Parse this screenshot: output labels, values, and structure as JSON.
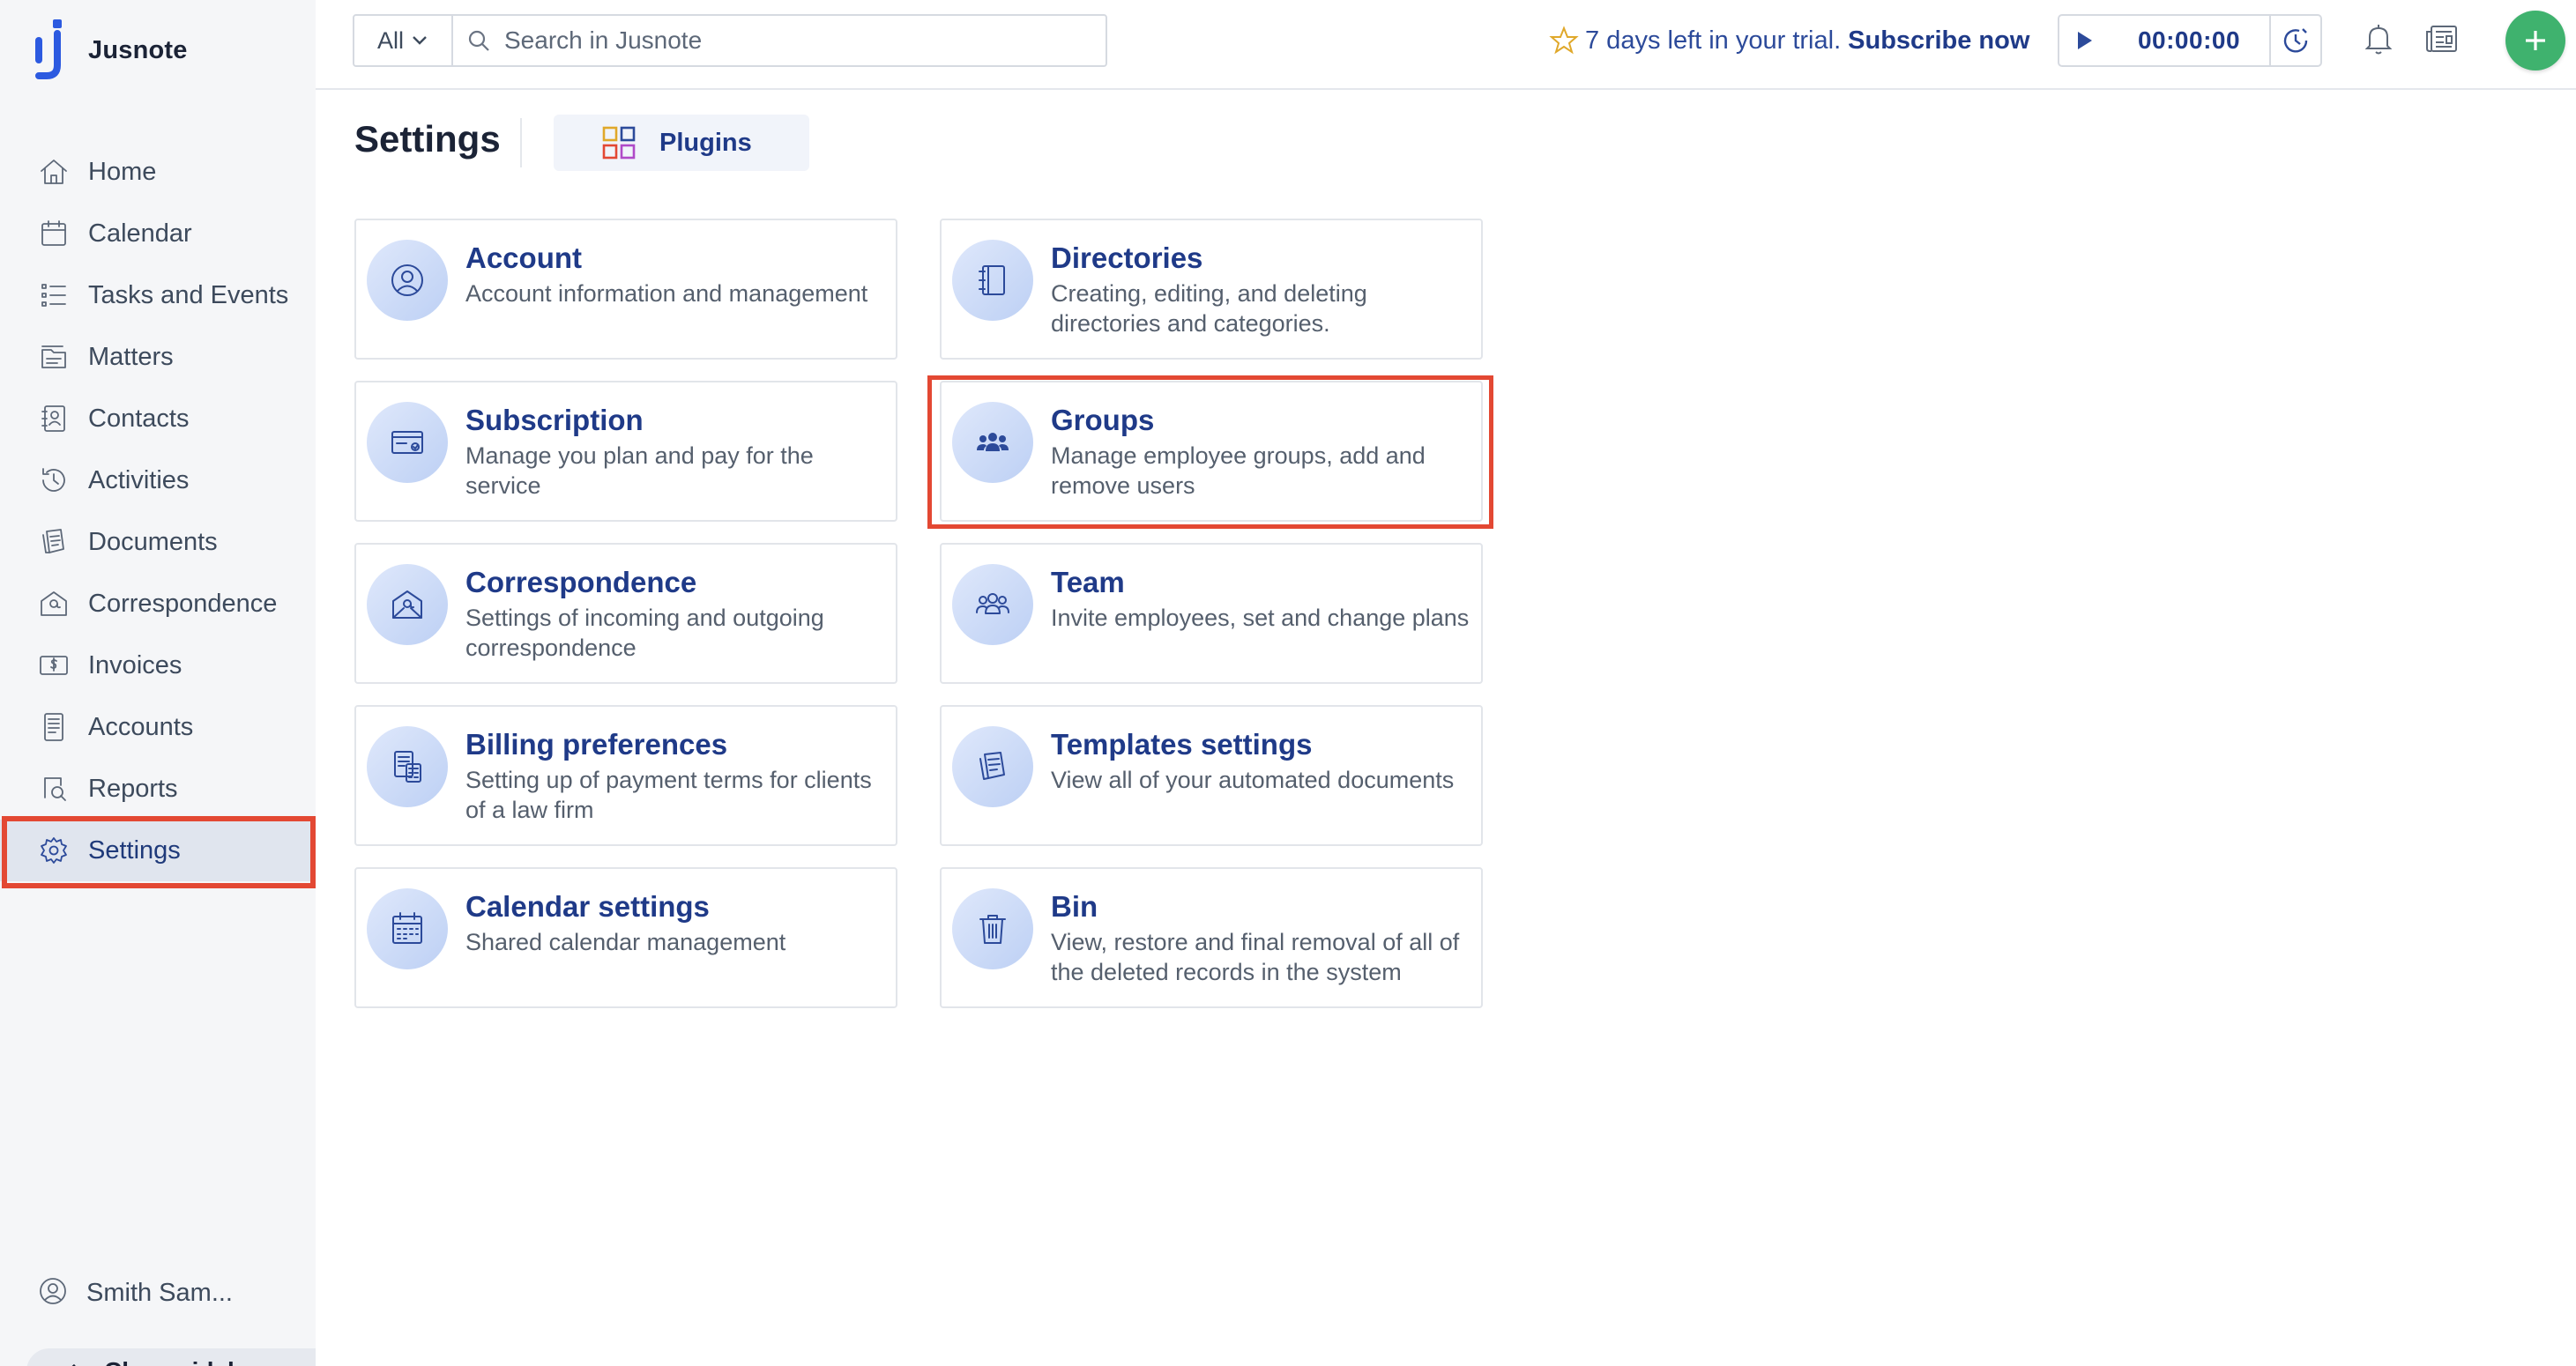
{
  "app": {
    "name": "Jusnote"
  },
  "sidebar": {
    "items": [
      {
        "key": "home",
        "label": "Home",
        "icon": "home-icon"
      },
      {
        "key": "calendar",
        "label": "Calendar",
        "icon": "calendar-icon"
      },
      {
        "key": "tasks",
        "label": "Tasks and Events",
        "icon": "tasks-list-icon"
      },
      {
        "key": "matters",
        "label": "Matters",
        "icon": "matters-folder-icon"
      },
      {
        "key": "contacts",
        "label": "Contacts",
        "icon": "contacts-book-icon"
      },
      {
        "key": "activities",
        "label": "Activities",
        "icon": "activity-history-icon"
      },
      {
        "key": "documents",
        "label": "Documents",
        "icon": "documents-icon"
      },
      {
        "key": "correspondence",
        "label": "Correspondence",
        "icon": "mail-at-icon"
      },
      {
        "key": "invoices",
        "label": "Invoices",
        "icon": "invoice-dollar-icon"
      },
      {
        "key": "accounts",
        "label": "Accounts",
        "icon": "accounts-ledger-icon"
      },
      {
        "key": "reports",
        "label": "Reports",
        "icon": "reports-search-icon"
      },
      {
        "key": "settings",
        "label": "Settings",
        "icon": "gear-icon",
        "active": true
      }
    ],
    "user_name": "Smith Sam...",
    "close_label": "Close sidebar"
  },
  "topbar": {
    "search_scope": "All",
    "search_placeholder": "Search in Jusnote",
    "trial_text": "7 days left in your trial.",
    "subscribe_label": "Subscribe now",
    "timer_value": "00:00:00"
  },
  "page": {
    "title": "Settings",
    "plugins_label": "Plugins"
  },
  "cards": [
    {
      "key": "account",
      "title": "Account",
      "desc": "Account information and management",
      "icon": "user-circle-icon"
    },
    {
      "key": "directories",
      "title": "Directories",
      "desc": "Creating, editing, and deleting directories and categories.",
      "icon": "notebook-icon"
    },
    {
      "key": "subscription",
      "title": "Subscription",
      "desc": "Manage you plan and pay for the service",
      "icon": "credit-card-icon"
    },
    {
      "key": "groups",
      "title": "Groups",
      "desc": "Manage employee groups, add and remove users",
      "icon": "user-group-icon"
    },
    {
      "key": "correspondence",
      "title": "Correspondence",
      "desc": "Settings of incoming and outgoing correspondence",
      "icon": "mail-at-icon"
    },
    {
      "key": "team",
      "title": "Team",
      "desc": "Invite employees, set and change plans",
      "icon": "team-icon"
    },
    {
      "key": "billing",
      "title": "Billing preferences",
      "desc": "Setting up of payment terms for clients of a law firm",
      "icon": "billing-calculator-icon"
    },
    {
      "key": "templates",
      "title": "Templates settings",
      "desc": "View all of your automated documents",
      "icon": "templates-docs-icon"
    },
    {
      "key": "calendar_settings",
      "title": "Calendar settings",
      "desc": "Shared calendar management",
      "icon": "calendar-icon"
    },
    {
      "key": "bin",
      "title": "Bin",
      "desc": "View, restore and final removal of all of the deleted records in the system",
      "icon": "trash-icon"
    }
  ],
  "colors": {
    "accent": "#1f3a88",
    "highlight": "#e34833",
    "add_button": "#3fb26e",
    "trial_star": "#e0a82a"
  }
}
